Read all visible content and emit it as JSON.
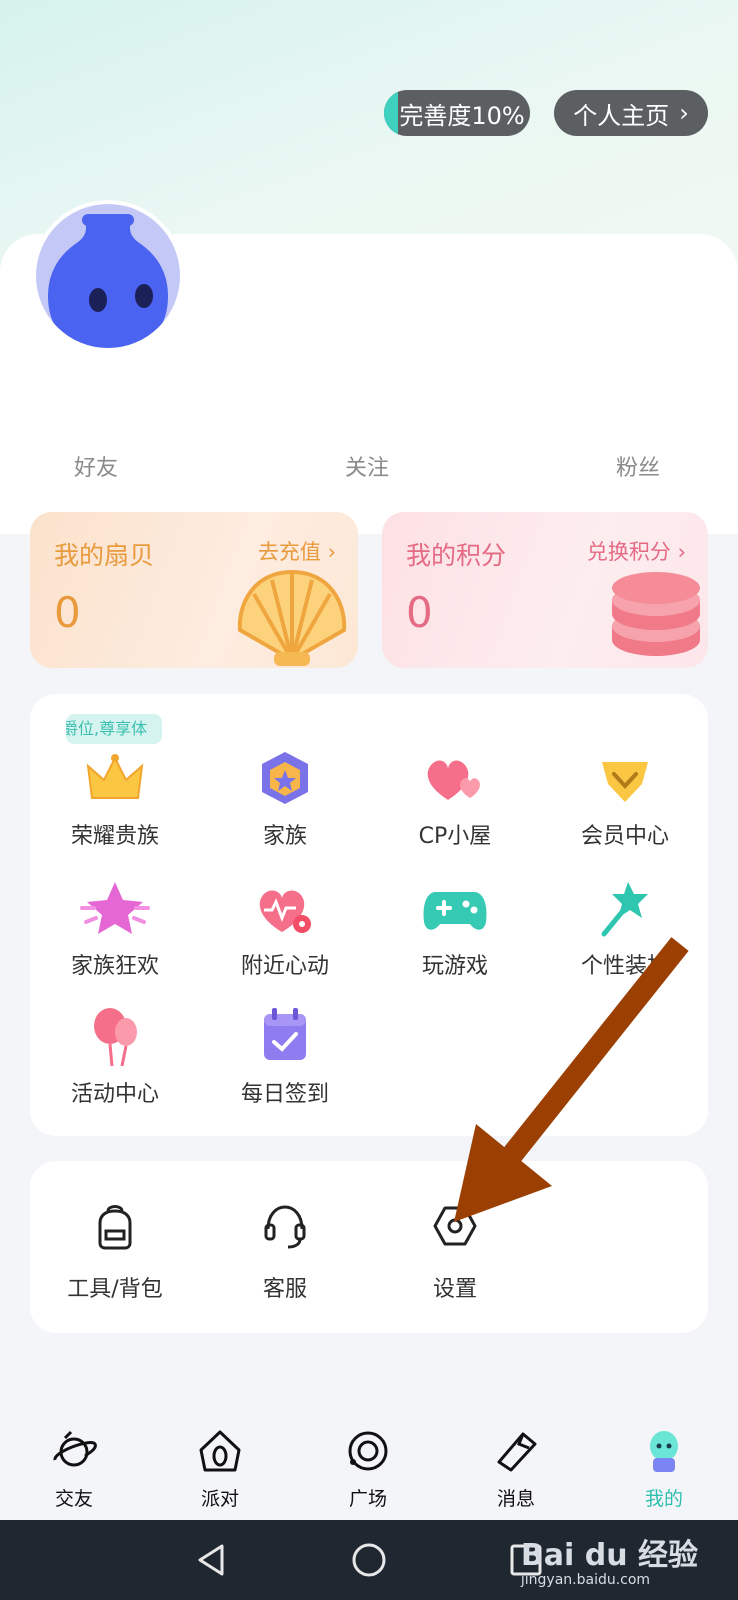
{
  "header": {
    "completion_label": "完善度10%",
    "completion_progress": 0.1,
    "profile_link_label": "个人主页"
  },
  "stats": {
    "friends_label": "好友",
    "following_label": "关注",
    "fans_label": "粉丝"
  },
  "wallet": {
    "shells": {
      "title": "我的扇贝",
      "link": "去充值",
      "value": "0",
      "color": "#e89a3c"
    },
    "points": {
      "title": "我的积分",
      "link": "兑换积分",
      "value": "0",
      "color": "#e56b84"
    }
  },
  "features": {
    "promo_badge": "爵位,尊享体",
    "items": [
      {
        "label": "荣耀贵族",
        "icon": "crown-icon"
      },
      {
        "label": "家族",
        "icon": "family-badge-icon"
      },
      {
        "label": "CP小屋",
        "icon": "hearts-icon"
      },
      {
        "label": "会员中心",
        "icon": "vip-diamond-icon"
      },
      {
        "label": "家族狂欢",
        "icon": "star-icon"
      },
      {
        "label": "附近心动",
        "icon": "heart-location-icon"
      },
      {
        "label": "玩游戏",
        "icon": "gamepad-icon"
      },
      {
        "label": "个性装扮",
        "icon": "magic-wand-icon"
      },
      {
        "label": "活动中心",
        "icon": "balloons-icon"
      },
      {
        "label": "每日签到",
        "icon": "calendar-check-icon"
      }
    ]
  },
  "tools": {
    "items": [
      {
        "label": "工具/背包",
        "icon": "backpack-icon"
      },
      {
        "label": "客服",
        "icon": "headset-icon"
      },
      {
        "label": "设置",
        "icon": "settings-hex-icon"
      }
    ]
  },
  "tabbar": {
    "items": [
      {
        "label": "交友",
        "icon": "planet-icon"
      },
      {
        "label": "派对",
        "icon": "party-house-icon"
      },
      {
        "label": "广场",
        "icon": "square-orbit-icon"
      },
      {
        "label": "消息",
        "icon": "message-note-icon"
      },
      {
        "label": "我的",
        "icon": "mine-avatar-icon",
        "active": true
      }
    ],
    "active_color": "#2fbfae"
  },
  "watermark": {
    "logo": "Bai du 经验",
    "domain": "jingyan.baidu.com"
  }
}
